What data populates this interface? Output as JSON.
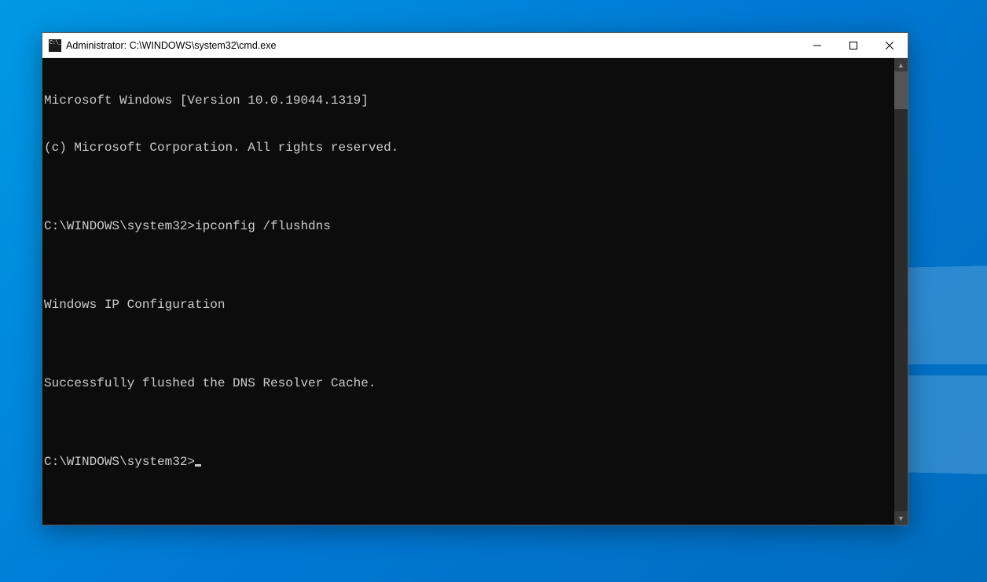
{
  "window": {
    "title": "Administrator: C:\\WINDOWS\\system32\\cmd.exe"
  },
  "console": {
    "lines": [
      "Microsoft Windows [Version 10.0.19044.1319]",
      "(c) Microsoft Corporation. All rights reserved.",
      "",
      "C:\\WINDOWS\\system32>ipconfig /flushdns",
      "",
      "Windows IP Configuration",
      "",
      "Successfully flushed the DNS Resolver Cache.",
      "",
      "C:\\WINDOWS\\system32>"
    ]
  },
  "scrollbar": {
    "up_glyph": "▲",
    "down_glyph": "▼"
  }
}
